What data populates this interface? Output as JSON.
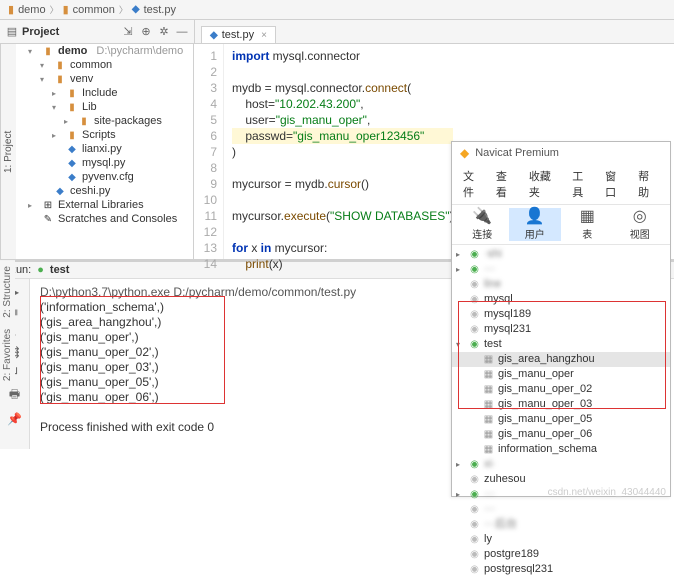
{
  "breadcrumb": [
    "demo",
    "common",
    "test.py"
  ],
  "project_toolbar_label": "Project",
  "open_tab": {
    "filename": "test.py"
  },
  "side_tab_left": "1: Project",
  "side_tabs_bottom": [
    "2: Favorites",
    "2: Structure"
  ],
  "tree": {
    "root": {
      "name": "demo",
      "path": "D:\\pycharm\\demo"
    },
    "items": [
      {
        "ind": 2,
        "arrow": "▾",
        "icon": "folder-open",
        "label": "common"
      },
      {
        "ind": 2,
        "arrow": "▾",
        "icon": "folder-open",
        "label": "venv"
      },
      {
        "ind": 3,
        "arrow": "▸",
        "icon": "folder",
        "label": "Include"
      },
      {
        "ind": 3,
        "arrow": "▾",
        "icon": "folder-open",
        "label": "Lib"
      },
      {
        "ind": 4,
        "arrow": "▸",
        "icon": "folder",
        "label": "site-packages"
      },
      {
        "ind": 3,
        "arrow": "▸",
        "icon": "folder",
        "label": "Scripts"
      },
      {
        "ind": 3,
        "arrow": "",
        "icon": "py",
        "label": "lianxi.py"
      },
      {
        "ind": 3,
        "arrow": "",
        "icon": "py",
        "label": "mysql.py"
      },
      {
        "ind": 3,
        "arrow": "",
        "icon": "py",
        "label": "pyvenv.cfg"
      },
      {
        "ind": 2,
        "arrow": "",
        "icon": "py",
        "label": "ceshi.py"
      },
      {
        "ind": 1,
        "arrow": "▸",
        "icon": "lib",
        "label": "External Libraries"
      },
      {
        "ind": 1,
        "arrow": "",
        "icon": "scratch",
        "label": "Scratches and Consoles"
      }
    ]
  },
  "code": {
    "lines_from": 1,
    "lines_to": 14,
    "content": [
      {
        "n": 1,
        "html": "<span class='kw'>import</span> mysql.connector"
      },
      {
        "n": 2,
        "html": ""
      },
      {
        "n": 3,
        "html": "mydb = mysql.connector.<span class='fn'>connect</span>("
      },
      {
        "n": 4,
        "html": "    host=<span class='str'>\"10.202.43.200\"</span>,"
      },
      {
        "n": 5,
        "html": "    user=<span class='str'>\"gis_manu_oper\"</span>,"
      },
      {
        "n": 6,
        "html": "    passwd=<span class='str'>\"gis_manu_oper123456\"</span>",
        "hl": true
      },
      {
        "n": 7,
        "html": ")"
      },
      {
        "n": 8,
        "html": ""
      },
      {
        "n": 9,
        "html": "mycursor = mydb.<span class='fn'>cursor</span>()"
      },
      {
        "n": 10,
        "html": ""
      },
      {
        "n": 11,
        "html": "mycursor.<span class='fn'>execute</span>(<span class='str'>\"SHOW DATABASES\"</span>)"
      },
      {
        "n": 12,
        "html": ""
      },
      {
        "n": 13,
        "html": "<span class='kw'>for</span> x <span class='kw'>in</span> mycursor:"
      },
      {
        "n": 14,
        "html": "    <span class='fn'>print</span>(x)"
      }
    ]
  },
  "run": {
    "header_label": "Run:",
    "config_name": "test",
    "command": "D:\\python3.7\\python.exe  D:/pycharm/demo/common/test.py",
    "output_lines": [
      "('information_schema',)",
      "('gis_area_hangzhou',)",
      "('gis_manu_oper',)",
      "('gis_manu_oper_02',)",
      "('gis_manu_oper_03',)",
      "('gis_manu_oper_05',)",
      "('gis_manu_oper_06',)"
    ],
    "exit_line": "Process finished with exit code 0"
  },
  "navicat": {
    "title": "Navicat Premium",
    "menu": [
      "文件",
      "查看",
      "收藏夹",
      "工具",
      "窗口",
      "帮助"
    ],
    "toolbar": [
      {
        "label": "连接",
        "icon": "🔌"
      },
      {
        "label": "用户",
        "icon": "👤",
        "active": true
      },
      {
        "label": "表",
        "icon": "▦"
      },
      {
        "label": "视图",
        "icon": "◎"
      }
    ],
    "nodes": [
      {
        "arrow": "▸",
        "cls": "db-ic",
        "label": "·shi",
        "blur": true
      },
      {
        "arrow": "▸",
        "cls": "db-ic",
        "label": "···",
        "blur": true
      },
      {
        "arrow": "",
        "cls": "db-off",
        "label": "line",
        "blur": true
      },
      {
        "arrow": "",
        "cls": "db-off",
        "label": "mysql"
      },
      {
        "arrow": "",
        "cls": "db-off",
        "label": "mysql189"
      },
      {
        "arrow": "",
        "cls": "db-off",
        "label": "mysql231"
      },
      {
        "arrow": "▾",
        "cls": "db-ic",
        "label": "test"
      }
    ],
    "test_children": [
      {
        "label": "gis_area_hangzhou",
        "sel": true
      },
      {
        "label": "gis_manu_oper"
      },
      {
        "label": "gis_manu_oper_02"
      },
      {
        "label": "gis_manu_oper_03"
      },
      {
        "label": "gis_manu_oper_05"
      },
      {
        "label": "gis_manu_oper_06"
      },
      {
        "label": "information_schema"
      }
    ],
    "nodes_after": [
      {
        "arrow": "▸",
        "cls": "db-ic",
        "label": "xi·",
        "blur": true
      },
      {
        "arrow": "",
        "cls": "db-off",
        "label": "zuhesou"
      },
      {
        "arrow": "▸",
        "cls": "db-ic",
        "label": "···",
        "blur": true
      },
      {
        "arrow": "",
        "cls": "db-off",
        "label": "···",
        "blur": true
      },
      {
        "arrow": "",
        "cls": "db-off",
        "label": "···后台",
        "blur": true
      },
      {
        "arrow": "",
        "cls": "db-off",
        "label": "ly"
      },
      {
        "arrow": "",
        "cls": "db-off",
        "label": "postgre189"
      },
      {
        "arrow": "",
        "cls": "db-off",
        "label": "postgresql231"
      }
    ]
  },
  "watermark": "csdn.net/weixin_43044440"
}
